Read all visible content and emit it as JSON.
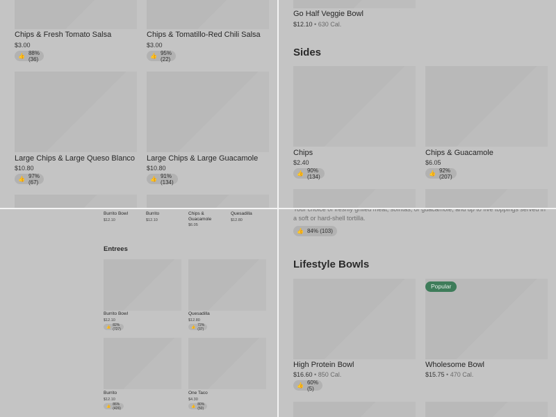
{
  "top_left": {
    "cards": [
      {
        "name": "Chips & Fresh Tomato Salsa",
        "price": "$3.00",
        "rating": "88% (36)"
      },
      {
        "name": "Chips & Tomatillo-Red Chili Salsa",
        "price": "$3.00",
        "rating": "95% (22)"
      },
      {
        "name": "Large Chips & Large Queso Blanco",
        "price": "$10.80",
        "rating": "97% (67)"
      },
      {
        "name": "Large Chips & Large Guacamole",
        "price": "$10.80",
        "rating": "91% (134)"
      }
    ]
  },
  "top_right": {
    "top_item": {
      "name": "Go Half Veggie Bowl",
      "price": "$12.10",
      "calories": "630 Cal."
    },
    "sides_title": "Sides",
    "sides": [
      {
        "name": "Chips",
        "price": "$2.40",
        "rating": "90% (134)"
      },
      {
        "name": "Chips & Guacamole",
        "price": "$6.05",
        "rating": "92% (207)"
      }
    ]
  },
  "bottom_left": {
    "top_row": [
      {
        "name": "Burrito Bowl",
        "price": "$12.10"
      },
      {
        "name": "Burrito",
        "price": "$12.10"
      },
      {
        "name": "Chips & Guacamole",
        "price": "$6.05"
      },
      {
        "name": "Quesadilla",
        "price": "$12.80"
      }
    ],
    "entrees_title": "Entrees",
    "entrees": [
      {
        "name": "Burrito Bowl",
        "price": "$12.10",
        "rating": "82% (727)"
      },
      {
        "name": "Quesadilla",
        "price": "$12.80",
        "rating": "72% (37)"
      },
      {
        "name": "Burrito",
        "price": "$12.10",
        "rating": "86% (426)"
      },
      {
        "name": "One Taco",
        "price": "$4.30",
        "rating": "80% (50)"
      }
    ]
  },
  "bottom_right": {
    "description": "Your choice of freshly grilled meat, sofritas, or guacamole, and up to five toppings served in a soft or hard-shell tortilla.",
    "description_rating": "84% (103)",
    "lifestyle_title": "Lifestyle Bowls",
    "popular_badge": "Popular",
    "bowls": [
      {
        "name": "High Protein Bowl",
        "price": "$16.60",
        "calories": "850 Cal.",
        "rating": "60% (5)"
      },
      {
        "name": "Wholesome Bowl",
        "price": "$15.75",
        "calories": "470 Cal."
      }
    ]
  },
  "icons": {
    "thumb": "thumbs-up-icon"
  },
  "colors": {
    "popular_badge": "#3e7c5a",
    "background": "#c4c4c4",
    "placeholder": "#b9b9b9"
  }
}
